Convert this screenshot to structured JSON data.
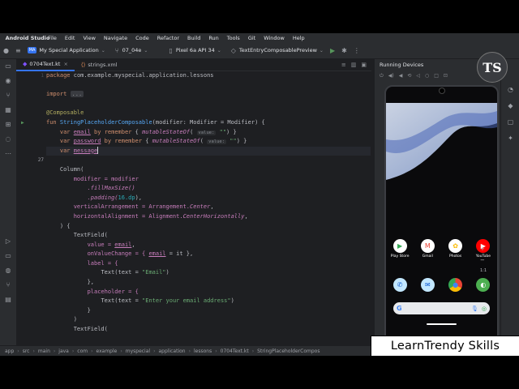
{
  "menubar": {
    "app": "Android Studio",
    "items": [
      "File",
      "Edit",
      "View",
      "Navigate",
      "Code",
      "Refactor",
      "Build",
      "Run",
      "Tools",
      "Git",
      "Window",
      "Help"
    ]
  },
  "toolbar": {
    "project_badge": "MA",
    "project": "My Special Application",
    "branch": "07_04e",
    "device": "Pixel 6a API 34",
    "run_config": "TextEntryComposablePreview"
  },
  "tabs": [
    {
      "label": "0704Text.kt",
      "active": true
    },
    {
      "label": "strings.xml",
      "active": false
    }
  ],
  "code": {
    "line_numbers": [
      "1",
      "",
      "",
      "",
      "",
      "",
      "",
      "",
      "",
      "27",
      "",
      "",
      "",
      "",
      "",
      "",
      "",
      "",
      "",
      "",
      "",
      "",
      "",
      "",
      "",
      "",
      ""
    ],
    "package_kw": "package",
    "package_name": "com.example.myspecial.application.lessons",
    "import_kw": "import",
    "import_fold": "...",
    "annotation": "@Composable",
    "fun_kw": "fun",
    "fun_name": "StringPlaceholderComposable",
    "fun_params": "(modifier: Modifier = Modifier) {",
    "var_kw": "var",
    "by_kw": "by",
    "remember": "remember",
    "mutable": "mutableStateOf",
    "hint_value": "value:",
    "email": "email",
    "password": "password",
    "message": "message",
    "empty_str": "\"\"",
    "column": "Column(",
    "modifier_assign": "modifier = modifier",
    "fill": ".fillMaxSize()",
    "padding": ".padding(",
    "padding_val": "16.dp",
    "padding_close": "),",
    "vertical": "verticalArrangement = Arrangement.",
    "center": "Center",
    "horizontal": "horizontalAlignment = Alignment.",
    "center_h": "CenterHorizontally",
    "col_close": ") {",
    "textfield": "TextField(",
    "value_assign": "value = ",
    "onchange": "onValueChange = { ",
    "eq_it": " = it },",
    "label_open": "label = {",
    "text_call": "Text(text = ",
    "email_str": "\"Email\"",
    "enter_email": "\"Enter your email address\"",
    "close_paren": ")",
    "close_brace": "},",
    "placeholder_open": "placeholder = {",
    "close_brace_only": "}",
    "paren_close": ")",
    "line_numbers_shown": {
      "first": "1",
      "current": "27"
    }
  },
  "right_panel": {
    "title": "Running Devices",
    "apps": [
      {
        "label": "Play Store",
        "color": "#ffffff",
        "glyph": "▶"
      },
      {
        "label": "Gmail",
        "color": "#ffffff",
        "glyph": "M"
      },
      {
        "label": "Photos",
        "color": "#ffffff",
        "glyph": "✿"
      },
      {
        "label": "YouTube",
        "color": "#ff0000",
        "glyph": "▶"
      }
    ],
    "dock": [
      {
        "color": "#c2e7ff",
        "glyph": "☏"
      },
      {
        "color": "#c2e7ff",
        "glyph": "✉"
      },
      {
        "color": "#4285f4",
        "glyph": "◉"
      },
      {
        "color": "#4caf50",
        "glyph": "◐"
      }
    ],
    "search_g": "G",
    "zoom_plus": "+",
    "zoom_minus": "−",
    "zoom_ratio": "1:1"
  },
  "statusbar": {
    "crumbs": [
      "app",
      "src",
      "main",
      "java",
      "com",
      "example",
      "myspecial",
      "application",
      "lessons",
      "0704Text.kt",
      "StringPlaceholderCompos"
    ]
  },
  "logo": {
    "text": "TS"
  },
  "watermark": {
    "text": "LearnTrendy Skills"
  },
  "colors": {
    "accent": "#3574f0",
    "keyword": "#cf8e6d",
    "function": "#56a8f5",
    "string": "#6aab73"
  }
}
